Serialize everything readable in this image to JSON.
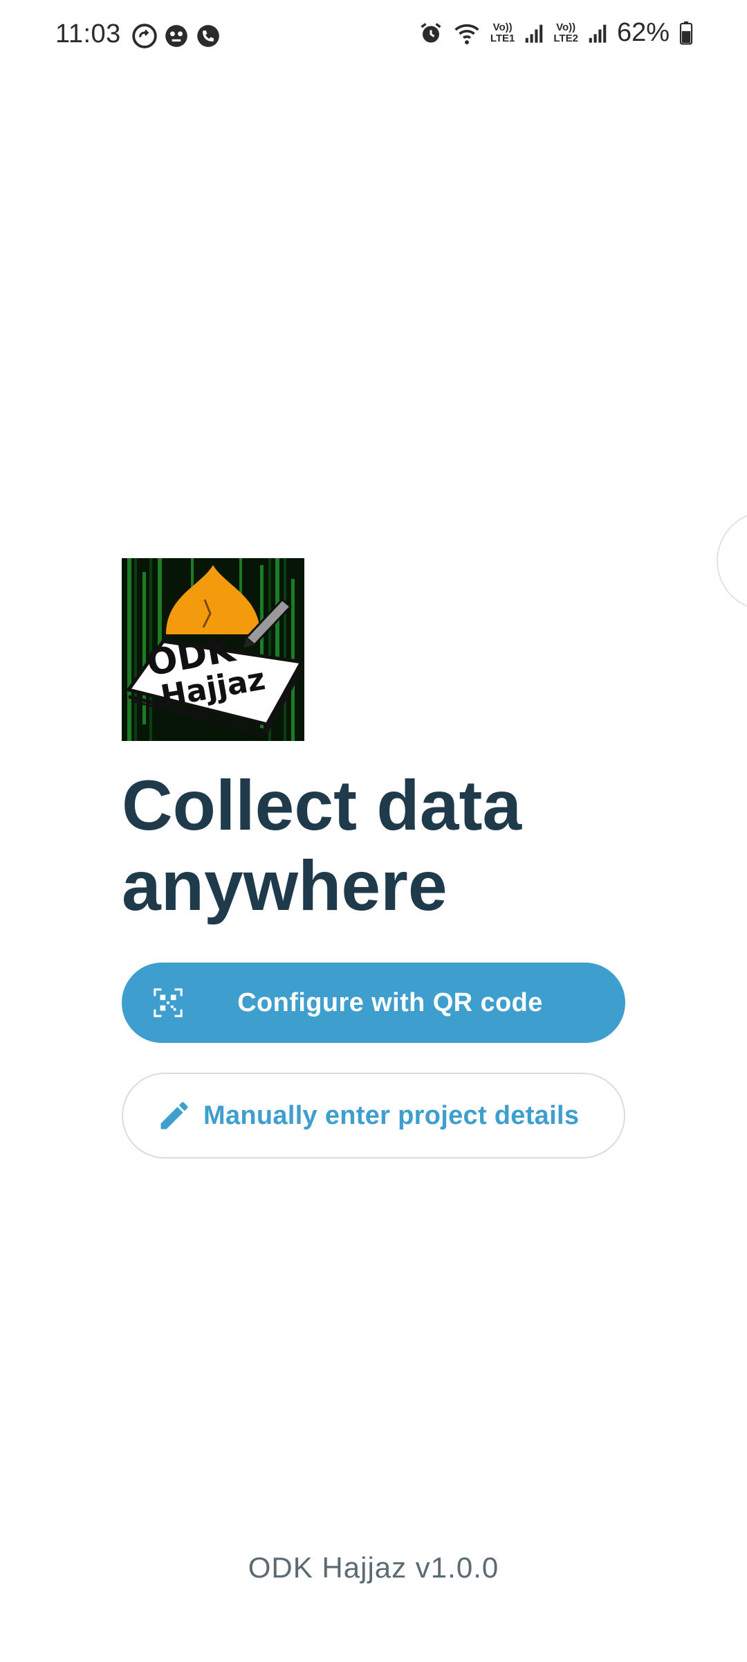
{
  "status_bar": {
    "time": "11:03",
    "battery": "62%",
    "sim1_top": "Vo))",
    "sim1_bottom": "LTE1",
    "sim2_top": "Vo))",
    "sim2_bottom": "LTE2"
  },
  "logo": {
    "line1": "ODK",
    "line2": "Hajjaz"
  },
  "headline": "Collect data anywhere",
  "buttons": {
    "qr_label": "Configure with QR code",
    "manual_label": "Manually enter project details"
  },
  "footer": {
    "version": "ODK Hajjaz v1.0.0"
  },
  "icons": {
    "qr": "qr-code-scan-icon",
    "manual": "pencil-icon"
  },
  "colors": {
    "primary": "#3e9fce",
    "headline": "#1f3a4a",
    "version": "#5c6b73"
  }
}
